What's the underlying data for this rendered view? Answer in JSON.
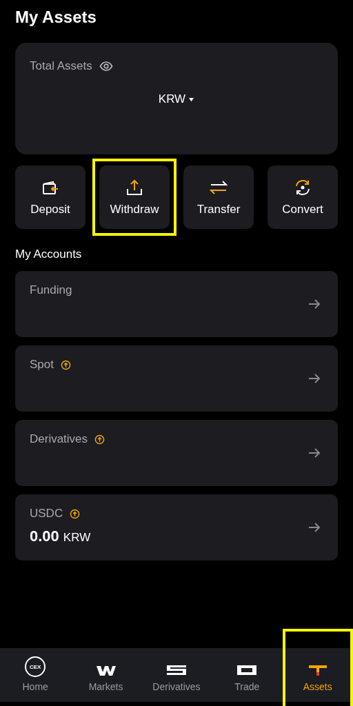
{
  "page_title": "My Assets",
  "total_assets": {
    "label": "Total Assets",
    "currency": "KRW"
  },
  "actions": [
    {
      "label": "Deposit",
      "kind": "deposit",
      "highlighted": false
    },
    {
      "label": "Withdraw",
      "kind": "withdraw",
      "highlighted": true
    },
    {
      "label": "Transfer",
      "kind": "transfer",
      "highlighted": false
    },
    {
      "label": "Convert",
      "kind": "convert",
      "highlighted": false
    }
  ],
  "accounts_heading": "My Accounts",
  "accounts": [
    {
      "name": "Funding",
      "upgrade_badge": false
    },
    {
      "name": "Spot",
      "upgrade_badge": true
    },
    {
      "name": "Derivatives",
      "upgrade_badge": true
    },
    {
      "name": "USDC",
      "upgrade_badge": true,
      "amount": "0.00",
      "unit": "KRW"
    }
  ],
  "bottom_nav": [
    {
      "label": "Home",
      "kind": "home",
      "icon_text": "CEX",
      "selected": false,
      "highlighted": false
    },
    {
      "label": "Markets",
      "kind": "markets",
      "selected": false,
      "highlighted": false
    },
    {
      "label": "Derivatives",
      "kind": "derivatives",
      "selected": false,
      "highlighted": false
    },
    {
      "label": "Trade",
      "kind": "trade",
      "selected": false,
      "highlighted": false
    },
    {
      "label": "Assets",
      "kind": "assets",
      "selected": true,
      "highlighted": true
    }
  ]
}
